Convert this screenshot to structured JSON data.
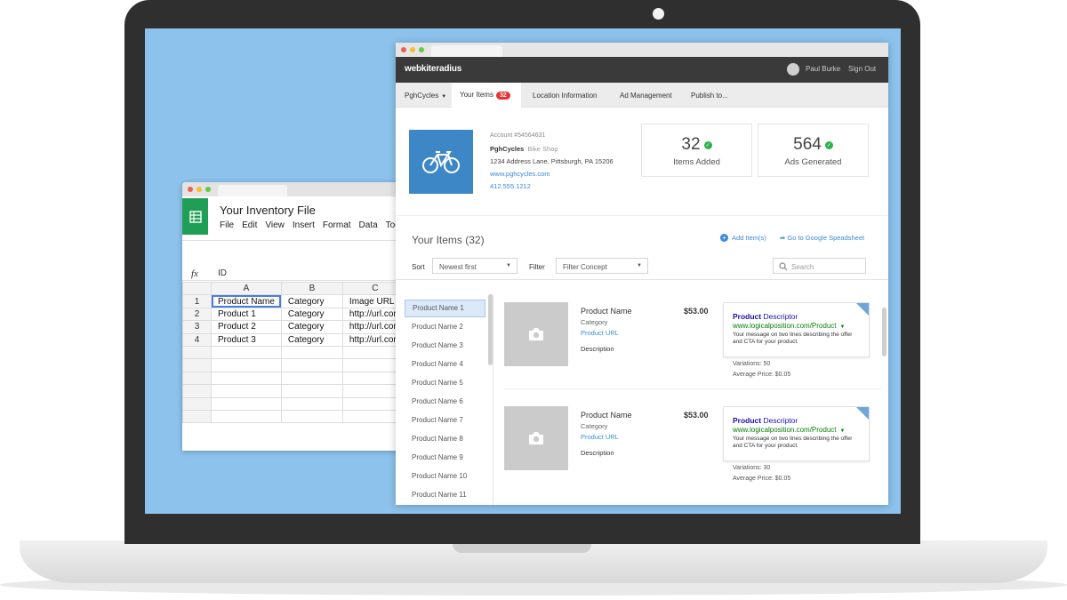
{
  "spreadsheet": {
    "title": "Your Inventory File",
    "menu": [
      "File",
      "Edit",
      "View",
      "Insert",
      "Format",
      "Data",
      "Too"
    ],
    "fx_label": "fx",
    "fx_value": "ID",
    "columns": [
      "A",
      "B",
      "C"
    ],
    "rows": [
      {
        "n": "1",
        "a": "Product Name",
        "b": "Category",
        "c": "Image URL"
      },
      {
        "n": "2",
        "a": "Product 1",
        "b": "Category",
        "c": "http://url.com"
      },
      {
        "n": "3",
        "a": "Product 2",
        "b": "Category",
        "c": "http://url.com"
      },
      {
        "n": "4",
        "a": "Product 3",
        "b": "Category",
        "c": "http://url.com"
      }
    ]
  },
  "app": {
    "brand": "webkiteradius",
    "user_name": "Paul Burke",
    "sign_out": "Sign Out",
    "nav": {
      "account": "PghCycles",
      "your_items": "Your Items",
      "your_items_count": "32",
      "location": "Location Information",
      "ads": "Ad Management",
      "publish": "Publish to..."
    },
    "profile": {
      "account": "Account #54564631",
      "name": "PghCycles",
      "type": "Bike Shop",
      "address": "1234 Address Lane, Pittsburgh, PA 15206",
      "website": "www.pghcycles.com",
      "phone": "412.555.1212"
    },
    "stats": [
      {
        "value": "32",
        "label": "Items Added"
      },
      {
        "value": "564",
        "label": "Ads Generated"
      }
    ],
    "items_title": "Your Items (32)",
    "add_items": "Add Item(s)",
    "go_to_sheet": "Go to Google Speadsheet",
    "sort_label": "Sort",
    "sort_value": "Newest first",
    "filter_label": "Filter",
    "filter_value": "Filter Concept",
    "search_placeholder": "Search",
    "list": [
      "Product Name 1",
      "Product Name 2",
      "Product Name 3",
      "Product Name 4",
      "Product Name 5",
      "Product Name 6",
      "Product Name 7",
      "Product Name 8",
      "Product Name 9",
      "Product Name 10",
      "Product Name 11"
    ],
    "products": [
      {
        "name": "Product Name",
        "category": "Category",
        "url": "Product URL",
        "description": "Description",
        "price": "$53.00",
        "ad_title_bold": "Product",
        "ad_title_rest": "Descriptor",
        "ad_url": "www.logicalposition.com/Product",
        "ad_body": "Your message on two lines describing the offer and CTA for your product.",
        "variations": "Variations: 50",
        "avg_price": "Average Price: $0.05"
      },
      {
        "name": "Product Name",
        "category": "Category",
        "url": "Product URL",
        "description": "Description",
        "price": "$53.00",
        "ad_title_bold": "Product",
        "ad_title_rest": "Descriptor",
        "ad_url": "www.logicalposition.com/Product",
        "ad_body": "Your message on two lines describing the offer and CTA for your product.",
        "variations": "Variations: 30",
        "avg_price": "Average Price: $0.05"
      }
    ]
  }
}
